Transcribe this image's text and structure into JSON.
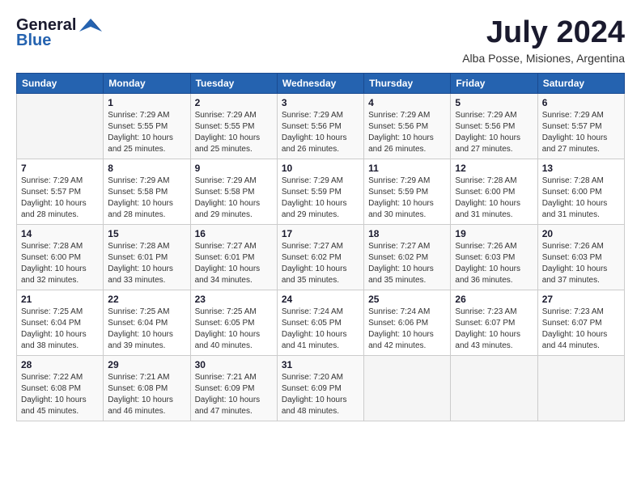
{
  "header": {
    "logo_general": "General",
    "logo_blue": "Blue",
    "month_year": "July 2024",
    "location": "Alba Posse, Misiones, Argentina"
  },
  "calendar": {
    "days_of_week": [
      "Sunday",
      "Monday",
      "Tuesday",
      "Wednesday",
      "Thursday",
      "Friday",
      "Saturday"
    ],
    "weeks": [
      [
        {
          "day": "",
          "info": ""
        },
        {
          "day": "1",
          "info": "Sunrise: 7:29 AM\nSunset: 5:55 PM\nDaylight: 10 hours\nand 25 minutes."
        },
        {
          "day": "2",
          "info": "Sunrise: 7:29 AM\nSunset: 5:55 PM\nDaylight: 10 hours\nand 25 minutes."
        },
        {
          "day": "3",
          "info": "Sunrise: 7:29 AM\nSunset: 5:56 PM\nDaylight: 10 hours\nand 26 minutes."
        },
        {
          "day": "4",
          "info": "Sunrise: 7:29 AM\nSunset: 5:56 PM\nDaylight: 10 hours\nand 26 minutes."
        },
        {
          "day": "5",
          "info": "Sunrise: 7:29 AM\nSunset: 5:56 PM\nDaylight: 10 hours\nand 27 minutes."
        },
        {
          "day": "6",
          "info": "Sunrise: 7:29 AM\nSunset: 5:57 PM\nDaylight: 10 hours\nand 27 minutes."
        }
      ],
      [
        {
          "day": "7",
          "info": "Sunrise: 7:29 AM\nSunset: 5:57 PM\nDaylight: 10 hours\nand 28 minutes."
        },
        {
          "day": "8",
          "info": "Sunrise: 7:29 AM\nSunset: 5:58 PM\nDaylight: 10 hours\nand 28 minutes."
        },
        {
          "day": "9",
          "info": "Sunrise: 7:29 AM\nSunset: 5:58 PM\nDaylight: 10 hours\nand 29 minutes."
        },
        {
          "day": "10",
          "info": "Sunrise: 7:29 AM\nSunset: 5:59 PM\nDaylight: 10 hours\nand 29 minutes."
        },
        {
          "day": "11",
          "info": "Sunrise: 7:29 AM\nSunset: 5:59 PM\nDaylight: 10 hours\nand 30 minutes."
        },
        {
          "day": "12",
          "info": "Sunrise: 7:28 AM\nSunset: 6:00 PM\nDaylight: 10 hours\nand 31 minutes."
        },
        {
          "day": "13",
          "info": "Sunrise: 7:28 AM\nSunset: 6:00 PM\nDaylight: 10 hours\nand 31 minutes."
        }
      ],
      [
        {
          "day": "14",
          "info": "Sunrise: 7:28 AM\nSunset: 6:00 PM\nDaylight: 10 hours\nand 32 minutes."
        },
        {
          "day": "15",
          "info": "Sunrise: 7:28 AM\nSunset: 6:01 PM\nDaylight: 10 hours\nand 33 minutes."
        },
        {
          "day": "16",
          "info": "Sunrise: 7:27 AM\nSunset: 6:01 PM\nDaylight: 10 hours\nand 34 minutes."
        },
        {
          "day": "17",
          "info": "Sunrise: 7:27 AM\nSunset: 6:02 PM\nDaylight: 10 hours\nand 35 minutes."
        },
        {
          "day": "18",
          "info": "Sunrise: 7:27 AM\nSunset: 6:02 PM\nDaylight: 10 hours\nand 35 minutes."
        },
        {
          "day": "19",
          "info": "Sunrise: 7:26 AM\nSunset: 6:03 PM\nDaylight: 10 hours\nand 36 minutes."
        },
        {
          "day": "20",
          "info": "Sunrise: 7:26 AM\nSunset: 6:03 PM\nDaylight: 10 hours\nand 37 minutes."
        }
      ],
      [
        {
          "day": "21",
          "info": "Sunrise: 7:25 AM\nSunset: 6:04 PM\nDaylight: 10 hours\nand 38 minutes."
        },
        {
          "day": "22",
          "info": "Sunrise: 7:25 AM\nSunset: 6:04 PM\nDaylight: 10 hours\nand 39 minutes."
        },
        {
          "day": "23",
          "info": "Sunrise: 7:25 AM\nSunset: 6:05 PM\nDaylight: 10 hours\nand 40 minutes."
        },
        {
          "day": "24",
          "info": "Sunrise: 7:24 AM\nSunset: 6:05 PM\nDaylight: 10 hours\nand 41 minutes."
        },
        {
          "day": "25",
          "info": "Sunrise: 7:24 AM\nSunset: 6:06 PM\nDaylight: 10 hours\nand 42 minutes."
        },
        {
          "day": "26",
          "info": "Sunrise: 7:23 AM\nSunset: 6:07 PM\nDaylight: 10 hours\nand 43 minutes."
        },
        {
          "day": "27",
          "info": "Sunrise: 7:23 AM\nSunset: 6:07 PM\nDaylight: 10 hours\nand 44 minutes."
        }
      ],
      [
        {
          "day": "28",
          "info": "Sunrise: 7:22 AM\nSunset: 6:08 PM\nDaylight: 10 hours\nand 45 minutes."
        },
        {
          "day": "29",
          "info": "Sunrise: 7:21 AM\nSunset: 6:08 PM\nDaylight: 10 hours\nand 46 minutes."
        },
        {
          "day": "30",
          "info": "Sunrise: 7:21 AM\nSunset: 6:09 PM\nDaylight: 10 hours\nand 47 minutes."
        },
        {
          "day": "31",
          "info": "Sunrise: 7:20 AM\nSunset: 6:09 PM\nDaylight: 10 hours\nand 48 minutes."
        },
        {
          "day": "",
          "info": ""
        },
        {
          "day": "",
          "info": ""
        },
        {
          "day": "",
          "info": ""
        }
      ]
    ]
  }
}
